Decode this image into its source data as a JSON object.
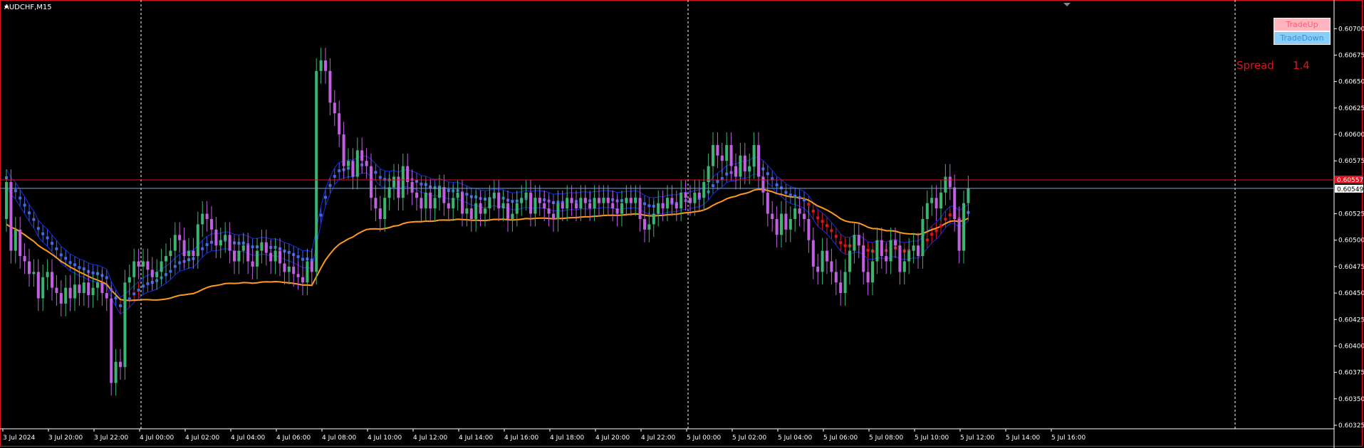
{
  "symbol_label": "AUDCHF,M15",
  "buttons": {
    "trade_up": "TradeUp",
    "trade_down": "TradeDown"
  },
  "spread": {
    "label": "Spread",
    "value": "1.4"
  },
  "price_labels": {
    "ask": "0.60557",
    "bid": "0.60549"
  },
  "colors": {
    "background": "#000000",
    "bull": "#3cb371",
    "bear": "#c060e0",
    "ema_fast": "#1a2ddc",
    "ema_slow": "#ff9a1f",
    "cloud_up": "#4169e1",
    "cloud_down": "#e0141e",
    "border": "#e0141e"
  },
  "chart_data": {
    "type": "candlestick",
    "symbol": "AUDCHF",
    "timeframe": "M15",
    "ylim": [
      0.60325,
      0.60715
    ],
    "y_ticks": [
      "0.60700",
      "0.60675",
      "0.60650",
      "0.60625",
      "0.60600",
      "0.60575",
      "0.60525",
      "0.60500",
      "0.60475",
      "0.60450",
      "0.60425",
      "0.60400",
      "0.60375",
      "0.60350",
      "0.60325"
    ],
    "x_ticks": [
      "3 Jul 2024",
      "3 Jul 20:00",
      "3 Jul 22:00",
      "4 Jul 00:00",
      "4 Jul 02:00",
      "4 Jul 04:00",
      "4 Jul 06:00",
      "4 Jul 08:00",
      "4 Jul 10:00",
      "4 Jul 12:00",
      "4 Jul 14:00",
      "4 Jul 16:00",
      "4 Jul 18:00",
      "4 Jul 20:00",
      "4 Jul 22:00",
      "5 Jul 00:00",
      "5 Jul 02:00",
      "5 Jul 04:00",
      "5 Jul 06:00",
      "5 Jul 08:00",
      "5 Jul 10:00",
      "5 Jul 12:00",
      "5 Jul 14:00",
      "5 Jul 16:00"
    ],
    "closes": [
      0.60555,
      0.6049,
      0.6051,
      0.60485,
      0.6048,
      0.60468,
      0.6047,
      0.60445,
      0.60465,
      0.6047,
      0.60455,
      0.6045,
      0.6044,
      0.60455,
      0.60445,
      0.60458,
      0.6045,
      0.6046,
      0.60448,
      0.60455,
      0.6046,
      0.6045,
      0.60445,
      0.60365,
      0.60385,
      0.6038,
      0.6046,
      0.60465,
      0.6048,
      0.60475,
      0.6048,
      0.60472,
      0.60465,
      0.6047,
      0.6048,
      0.60485,
      0.6049,
      0.60505,
      0.605,
      0.60485,
      0.6049,
      0.60485,
      0.60515,
      0.60525,
      0.6052,
      0.6051,
      0.60495,
      0.605,
      0.60505,
      0.6049,
      0.6048,
      0.6049,
      0.60495,
      0.6048,
      0.60475,
      0.6049,
      0.60498,
      0.60488,
      0.6048,
      0.6049,
      0.60478,
      0.6047,
      0.60475,
      0.60468,
      0.60465,
      0.6046,
      0.6048,
      0.6047,
      0.6066,
      0.6067,
      0.6066,
      0.6063,
      0.6062,
      0.606,
      0.6057,
      0.60575,
      0.6056,
      0.60585,
      0.60575,
      0.6057,
      0.6054,
      0.6053,
      0.6052,
      0.6054,
      0.6055,
      0.6056,
      0.6054,
      0.6057,
      0.60555,
      0.60545,
      0.6054,
      0.6053,
      0.60545,
      0.6053,
      0.6054,
      0.6055,
      0.60535,
      0.6053,
      0.6054,
      0.60545,
      0.60525,
      0.6053,
      0.6052,
      0.60535,
      0.60525,
      0.6053,
      0.6054,
      0.60545,
      0.6053,
      0.60535,
      0.6052,
      0.60525,
      0.60535,
      0.6054,
      0.60545,
      0.60525,
      0.6054,
      0.60535,
      0.6053,
      0.60525,
      0.6052,
      0.60535,
      0.6053,
      0.6054,
      0.60535,
      0.6053,
      0.6054,
      0.60535,
      0.6053,
      0.6054,
      0.60535,
      0.6054,
      0.60535,
      0.6053,
      0.60525,
      0.60535,
      0.6054,
      0.60535,
      0.6054,
      0.6052,
      0.6051,
      0.60515,
      0.60525,
      0.60535,
      0.6053,
      0.6054,
      0.60535,
      0.6053,
      0.60545,
      0.6054,
      0.60535,
      0.60545,
      0.6054,
      0.60555,
      0.6057,
      0.6059,
      0.6058,
      0.60575,
      0.6059,
      0.6057,
      0.6056,
      0.6058,
      0.60565,
      0.6057,
      0.6059,
      0.6056,
      0.60545,
      0.60525,
      0.6052,
      0.60505,
      0.60525,
      0.6051,
      0.6052,
      0.6053,
      0.60525,
      0.6052,
      0.605,
      0.60475,
      0.6047,
      0.6049,
      0.6048,
      0.6047,
      0.6046,
      0.6045,
      0.6047,
      0.6049,
      0.60505,
      0.60495,
      0.6047,
      0.6046,
      0.6048,
      0.605,
      0.60485,
      0.6048,
      0.605,
      0.60495,
      0.6047,
      0.6048,
      0.6049,
      0.60495,
      0.60485,
      0.6052,
      0.60535,
      0.6054,
      0.6053,
      0.60545,
      0.6056,
      0.6055,
      0.6052,
      0.6049,
      0.60535,
      0.60549
    ]
  }
}
